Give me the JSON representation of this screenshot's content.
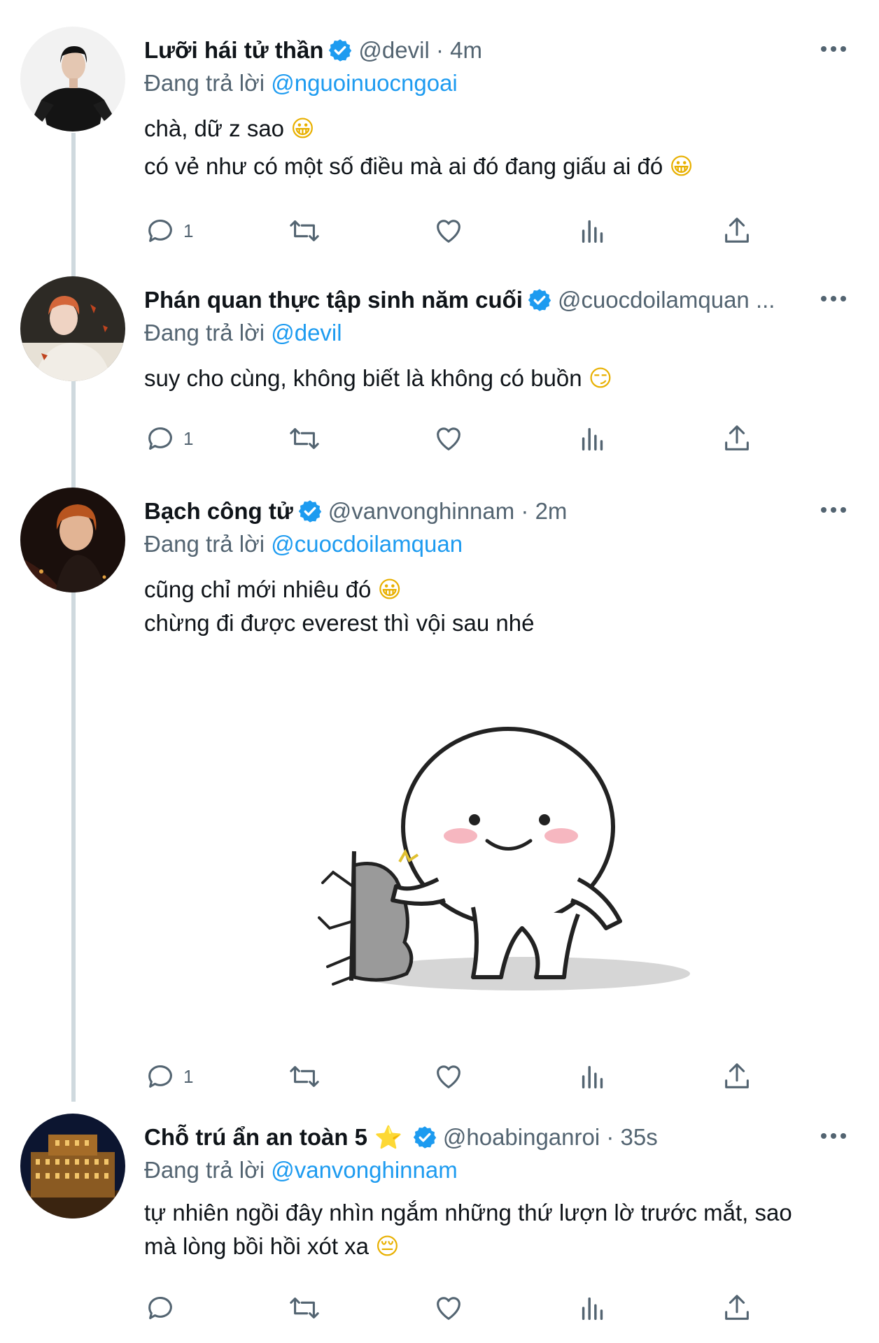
{
  "tweets": [
    {
      "name": "Lưỡi hái tử thần",
      "handle": "@devil",
      "time": "4m",
      "reply_prefix": "Đang trả lời",
      "reply_to": "@nguoinuocngoai",
      "lines": [
        "chà, dữ z sao",
        "có vẻ như có một số điều mà ai đó đang giấu ai đó"
      ],
      "emojis": [
        "😀",
        "😀"
      ],
      "reply_count": "1"
    },
    {
      "name": "Phán quan thực tập sinh năm cuối",
      "handle": "@cuocdoilamquan ...",
      "reply_prefix": "Đang trả lời",
      "reply_to": "@devil",
      "lines": [
        "suy cho cùng, không biết là không có buồn"
      ],
      "emojis": [
        "😏"
      ],
      "reply_count": "1"
    },
    {
      "name": "Bạch công tử",
      "handle": "@vanvonghinnam",
      "time": "2m",
      "reply_prefix": "Đang trả lời",
      "reply_to": "@cuocdoilamquan",
      "lines": [
        "cũng chỉ mới nhiêu đó",
        "chừng đi được everest thì vội sau nhé"
      ],
      "emojis": [
        "😀"
      ],
      "reply_count": "1"
    },
    {
      "name": "Chỗ trú ẩn an toàn 5",
      "star": "⭐",
      "handle": "@hoabinganroi",
      "time": "35s",
      "reply_prefix": "Đang trả lời",
      "reply_to": "@vanvonghinnam",
      "lines": [
        "tự nhiên ngồi đây nhìn ngắm những thứ lượn lờ trước mắt, sao",
        "mà lòng bồi hồi xót xa"
      ],
      "emojis": [
        "😔"
      ]
    }
  ],
  "separator": " · ",
  "icons": [
    "reply-icon",
    "retweet-icon",
    "like-icon",
    "views-icon",
    "share-icon",
    "more-icon",
    "verified-badge-icon"
  ],
  "colors": {
    "accent": "#1d9bf0",
    "secondary_text": "#536471",
    "thread_line": "#cfd9de"
  }
}
